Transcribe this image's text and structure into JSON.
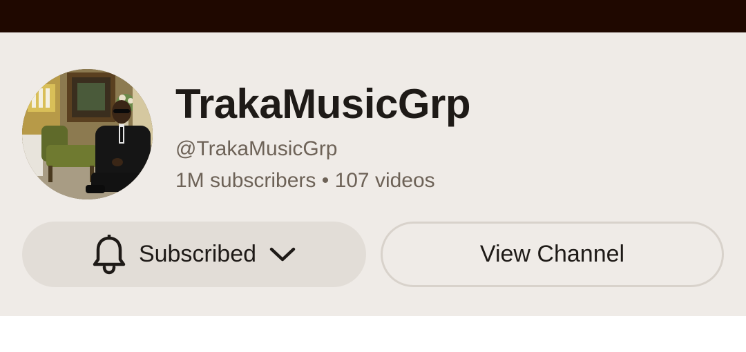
{
  "channel": {
    "name": "TrakaMusicGrp",
    "handle": "@TrakaMusicGrp",
    "stats": "1M subscribers • 107 videos",
    "avatar_icon": "channel-avatar-photo"
  },
  "actions": {
    "subscribed_label": "Subscribed",
    "subscribed_icon": "bell-icon",
    "dropdown_icon": "chevron-down-icon",
    "view_channel_label": "View Channel"
  },
  "colors": {
    "status_bar": "#1f0800",
    "card_background": "#efebe7",
    "subscribed_button": "#e2ddd7",
    "primary_text": "#1e1a17",
    "secondary_text": "#6d6257"
  }
}
